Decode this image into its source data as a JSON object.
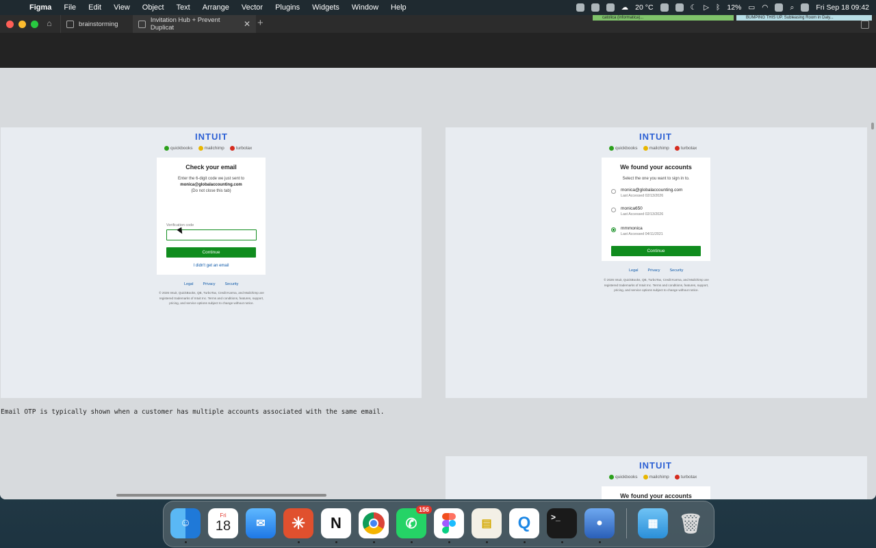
{
  "menubar": {
    "app": "Figma",
    "menus": [
      "File",
      "Edit",
      "View",
      "Object",
      "Text",
      "Arrange",
      "Vector",
      "Plugins",
      "Widgets",
      "Window",
      "Help"
    ],
    "weather": "20 °C",
    "battery": "12%",
    "datetime": "Fri Sep 18  09:42"
  },
  "tabs": {
    "tab1": "brainstorming",
    "tab2": "Invitation Hub + Prevent Duplicat",
    "notif1": "catolica (informatica)...",
    "notif2": "BUMPING THIS UP. Subleasing Room in Daly..."
  },
  "brand": {
    "logo": "INTUIT",
    "quickbooks": "quickbooks",
    "mailchimp": "mailchimp",
    "turbotax": "turbotax"
  },
  "frameA": {
    "title": "Check your email",
    "line1": "Enter the 6-digit code we just sent to",
    "email": "monica@globalaccounting.com",
    "line3": "(Do not close this tab)",
    "field_label": "Verification code",
    "button": "Continue",
    "link": "I didn't get an email"
  },
  "frameB": {
    "title": "We found your accounts",
    "subtitle": "Select the one you want to sign in to.",
    "accounts": [
      {
        "name": "monica@globalaccounting.com",
        "date": "Last Accessed 02/13/2026"
      },
      {
        "name": "monica650",
        "date": "Last Accessed 02/13/2026"
      },
      {
        "name": "mmmonica",
        "date": "Last Accessed 04/11/2021"
      }
    ],
    "button": "Continue"
  },
  "frameC": {
    "title": "We found your accounts"
  },
  "footer": {
    "legal": "Legal",
    "privacy": "Privacy",
    "security": "Security",
    "fineprint": "© 2026 Intuit, QuickBooks, QB, TurboTax, Credit Karma, and Mailchimp are registered trademarks of Intuit Inc. Terms and conditions, features, support, pricing, and service options subject to change without notice."
  },
  "note": "Email OTP is typically shown when a customer has multiple accounts associated with the same email.",
  "dock": {
    "calendar_month": "Fri",
    "calendar_day": "18",
    "whatsapp_badge": "156"
  },
  "colors": {
    "intuit_blue": "#2b5fd4",
    "continue_green": "#108c1e",
    "link_blue": "#0b57a8"
  }
}
